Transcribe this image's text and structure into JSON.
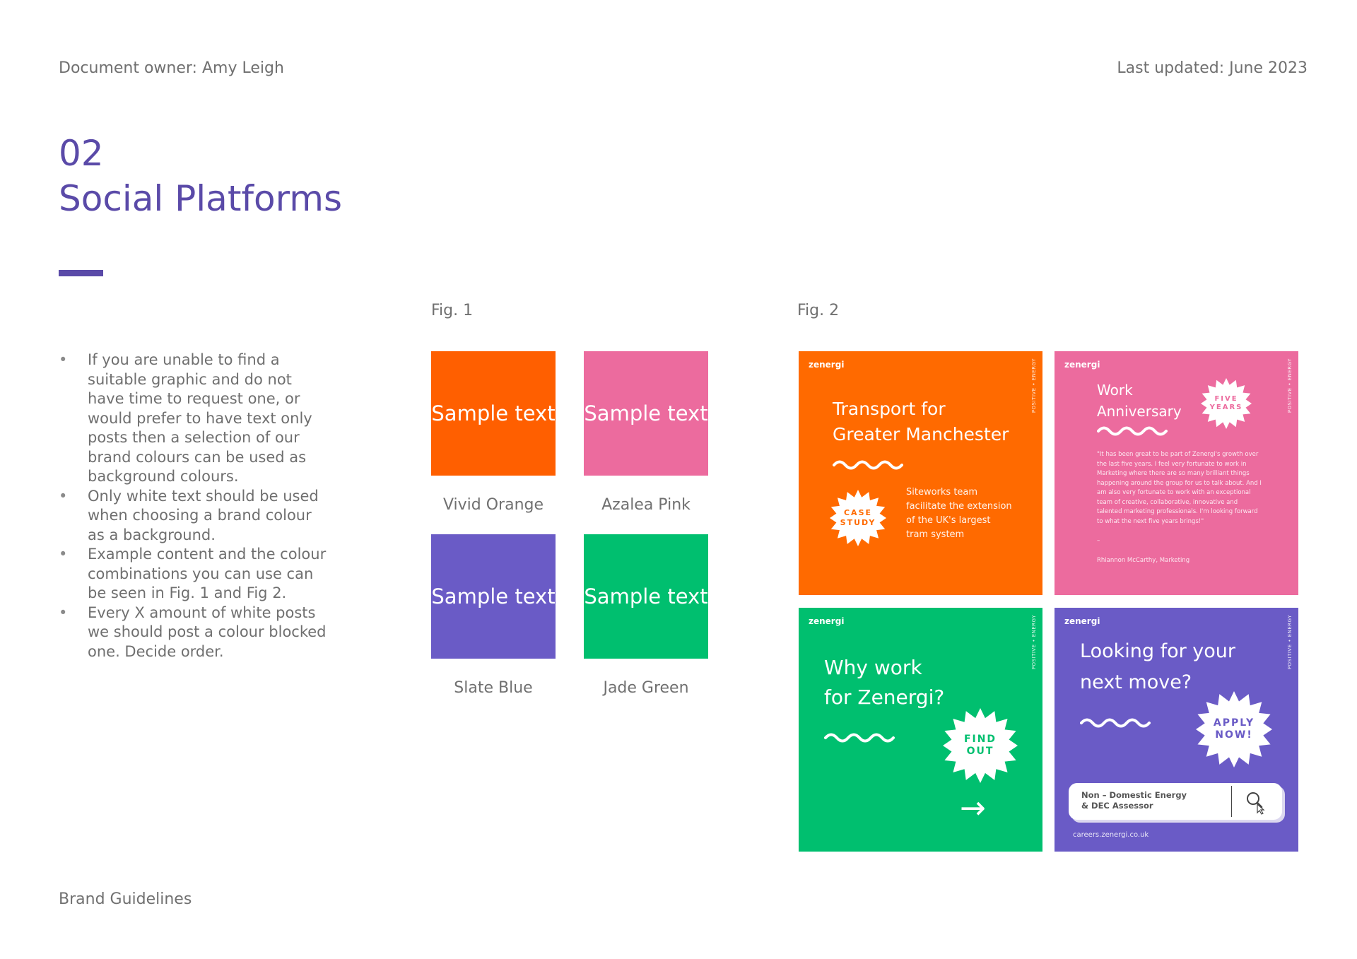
{
  "header": {
    "document_owner": "Document owner: Amy Leigh",
    "last_updated": "Last updated: June 2023"
  },
  "section": {
    "number": "02",
    "title": "Social Platforms"
  },
  "bullets": [
    "If you are unable to find a suitable graphic and do not have time to request one, or would prefer to have text only posts then a selection of our brand colours can be used as background colours.",
    "Only white text should be used when choosing a brand colour as a background.",
    "Example content and the colour combinations you can use can be seen in Fig. 1 and Fig 2.",
    "Every X amount of white posts we should post a colour blocked one.  Decide order."
  ],
  "fig1": {
    "label": "Fig. 1",
    "swatches": [
      {
        "text": "Sample text",
        "name": "Vivid Orange",
        "color": "#ff5f00"
      },
      {
        "text": "Sample text",
        "name": "Azalea Pink",
        "color": "#ec6b9e"
      },
      {
        "text": "Sample text",
        "name": "Slate Blue",
        "color": "#6a5bc6"
      },
      {
        "text": "Sample text",
        "name": "Jade Green",
        "color": "#00bf6f"
      }
    ]
  },
  "fig2": {
    "label": "Fig. 2",
    "posts": [
      {
        "logo": "zenergi",
        "tag": "POSITIVE • ENERGY",
        "headline_1": "Transport for",
        "headline_2": "Greater Manchester",
        "badge_1": "CASE",
        "badge_2": "STUDY",
        "body": [
          "Siteworks team",
          "facilitate the extension",
          "of the UK's largest",
          "tram system"
        ],
        "color": "#ff6a00"
      },
      {
        "logo": "zenergi",
        "tag": "POSITIVE • ENERGY",
        "headline_1": "Work",
        "headline_2": "Anniversary",
        "badge_1": "FIVE",
        "badge_2": "YEARS",
        "quote": "\"It has been great to be part of Zenergi's growth over the last five years. I feel very fortunate to work in Marketing where there are so many brilliant things happening around the group for us to talk about. And I am also very fortunate to work with an exceptional team of creative, collaborative, innovative and talented marketing professionals. I'm looking forward to what the next five years brings!\"",
        "dash": "–",
        "attribution": "Rhiannon McCarthy, Marketing",
        "color": "#ec6b9e"
      },
      {
        "logo": "zenergi",
        "tag": "POSITIVE • ENERGY",
        "headline_1": "Why work",
        "headline_2": "for Zenergi?",
        "badge_1": "FIND",
        "badge_2": "OUT",
        "arrow": "→",
        "color": "#00bf6f"
      },
      {
        "logo": "zenergi",
        "tag": "POSITIVE • ENERGY",
        "headline_1": "Looking for your",
        "headline_2": "next move?",
        "badge_1": "APPLY",
        "badge_2": "NOW!",
        "search_1": "Non – Domestic Energy",
        "search_2": "& DEC Assessor",
        "url": "careers.zenergi.co.uk",
        "color": "#6a5bc6"
      }
    ]
  },
  "footer": {
    "label": "Brand Guidelines"
  },
  "icons": {
    "squiggle": "squiggle-icon",
    "burst": "starburst-badge-icon",
    "search": "search-icon",
    "cursor": "hand-cursor-icon",
    "arrow": "arrow-right-icon"
  }
}
